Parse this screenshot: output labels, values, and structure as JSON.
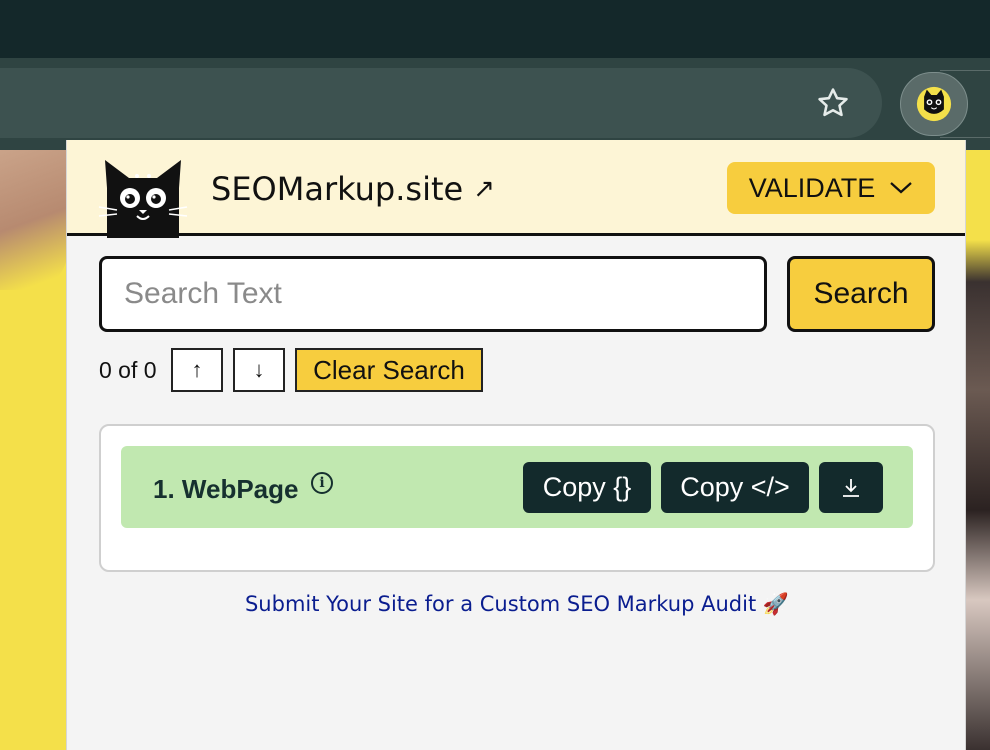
{
  "browser": {
    "star_icon": "star-outline-icon",
    "extension_icon": "black-cat-icon"
  },
  "header": {
    "logo_icon": "black-cat-logo-icon",
    "brand": "SEOMarkup.site",
    "external_icon": "external-arrow-icon",
    "validate_label": "VALIDATE",
    "validate_icon": "chevron-down-icon"
  },
  "search": {
    "placeholder": "Search Text",
    "value": "",
    "button_label": "Search",
    "count": "0 of 0",
    "up_icon": "arrow-up-icon",
    "down_icon": "arrow-down-icon",
    "clear_label": "Clear Search"
  },
  "results": [
    {
      "title": "1. WebPage",
      "info_icon": "info-icon",
      "copy_json_label": "Copy {}",
      "copy_html_label": "Copy </>",
      "download_icon": "download-icon"
    }
  ],
  "footer": {
    "audit_link": "Submit Your Site for a Custom SEO Markup Audit",
    "audit_emoji": "🚀"
  },
  "colors": {
    "accent_yellow": "#f7cd3e",
    "header_bg": "#fdf5d6",
    "result_green": "#c1e8b0",
    "dark_button": "#132a2c",
    "link_blue": "#0a1d8f"
  }
}
